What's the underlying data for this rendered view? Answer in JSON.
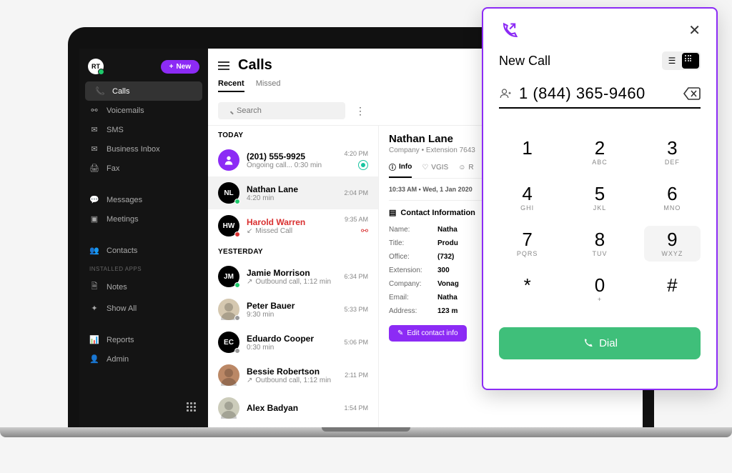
{
  "sidebar": {
    "user_initials": "RT",
    "new_button_label": "New",
    "items": [
      {
        "label": "Calls",
        "icon": "📞",
        "active": true
      },
      {
        "label": "Voicemails",
        "icon": "⚯"
      },
      {
        "label": "SMS",
        "icon": "✉"
      },
      {
        "label": "Business Inbox",
        "icon": "✉"
      },
      {
        "label": "Fax",
        "icon": "🖨"
      }
    ],
    "items2": [
      {
        "label": "Messages",
        "icon": "💬"
      },
      {
        "label": "Meetings",
        "icon": "▣"
      }
    ],
    "items3": [
      {
        "label": "Contacts",
        "icon": "👥"
      }
    ],
    "installed_label": "INSTALLED APPS",
    "apps": [
      {
        "label": "Notes",
        "icon": "🗎"
      },
      {
        "label": "Show All",
        "icon": "✦"
      }
    ],
    "items4": [
      {
        "label": "Reports",
        "icon": "📊"
      },
      {
        "label": "Admin",
        "icon": "👤"
      }
    ]
  },
  "main": {
    "title": "Calls",
    "tabs": [
      "Recent",
      "Missed"
    ],
    "active_tab": 0,
    "search_placeholder": "Search",
    "sections": [
      {
        "label": "TODAY",
        "items": [
          {
            "name": "(201) 555-9925",
            "sub": "Ongoing call... 0:30 min",
            "time": "4:20 PM",
            "avatar_bg": "#8c2bf5",
            "avatar_text": "",
            "avatar_icon": "person",
            "live": true
          },
          {
            "name": "Nathan Lane",
            "sub": "4:20 min",
            "time": "2:04 PM",
            "avatar_bg": "#000",
            "avatar_text": "NL",
            "dot": "#1fc96b",
            "selected": true
          },
          {
            "name": "Harold Warren",
            "sub": "Missed Call",
            "sub_pre": "↙",
            "time": "9:35 AM",
            "avatar_bg": "#000",
            "avatar_text": "HW",
            "dot": "#d93030",
            "missed": true,
            "vm": true
          }
        ]
      },
      {
        "label": "YESTERDAY",
        "items": [
          {
            "name": "Jamie Morrison",
            "sub": "Outbound call, 1:12 min",
            "sub_pre": "↗",
            "time": "6:34 PM",
            "avatar_bg": "#000",
            "avatar_text": "JM",
            "dot": "#1fc96b"
          },
          {
            "name": "Peter Bauer",
            "sub": "9:30 min",
            "time": "5:33 PM",
            "avatar_bg": "#d5c8b0",
            "avatar_text": "",
            "avatar_img": true,
            "dot": "#999"
          },
          {
            "name": "Eduardo Cooper",
            "sub": "0:30 min",
            "time": "5:06 PM",
            "avatar_bg": "#000",
            "avatar_text": "EC",
            "dot": "#999"
          },
          {
            "name": "Bessie Robertson",
            "sub": "Outbound call, 1:12 min",
            "sub_pre": "↗",
            "time": "2:11 PM",
            "avatar_bg": "#b86",
            "avatar_text": "",
            "avatar_img": true
          },
          {
            "name": "Alex Badyan",
            "sub": "",
            "time": "1:54 PM",
            "avatar_bg": "#ccb",
            "avatar_text": "",
            "avatar_img": true
          }
        ]
      }
    ]
  },
  "detail": {
    "name": "Nathan Lane",
    "company_label": "Company",
    "ext_label": "Extension 7643",
    "tabs": [
      {
        "label": "Info",
        "icon": "ⓘ",
        "active": true
      },
      {
        "label": "VGIS",
        "icon": "♡"
      },
      {
        "label": "R",
        "icon": "☺"
      }
    ],
    "timestamp": "10:33 AM  •  Wed, 1 Jan 2020",
    "contact_heading": "Contact Information",
    "fields": [
      {
        "label": "Name:",
        "value": "Natha"
      },
      {
        "label": "Title:",
        "value": "Produ"
      },
      {
        "label": "Office:",
        "value": "(732)"
      },
      {
        "label": "Extension:",
        "value": "300"
      },
      {
        "label": "Company:",
        "value": "Vonag"
      },
      {
        "label": "Email:",
        "value": "Natha"
      },
      {
        "label": "Address:",
        "value": "123 m"
      }
    ],
    "edit_label": "Edit contact info"
  },
  "dialer": {
    "title": "New Call",
    "number": "1 (844) 365-9460",
    "keys": [
      {
        "d": "1",
        "l": ""
      },
      {
        "d": "2",
        "l": "ABC"
      },
      {
        "d": "3",
        "l": "DEF"
      },
      {
        "d": "4",
        "l": "GHI"
      },
      {
        "d": "5",
        "l": "JKL"
      },
      {
        "d": "6",
        "l": "MNO"
      },
      {
        "d": "7",
        "l": "PQRS"
      },
      {
        "d": "8",
        "l": "TUV"
      },
      {
        "d": "9",
        "l": "WXYZ",
        "hl": true
      },
      {
        "d": "*",
        "l": ""
      },
      {
        "d": "0",
        "l": "+"
      },
      {
        "d": "#",
        "l": ""
      }
    ],
    "dial_label": "Dial"
  }
}
